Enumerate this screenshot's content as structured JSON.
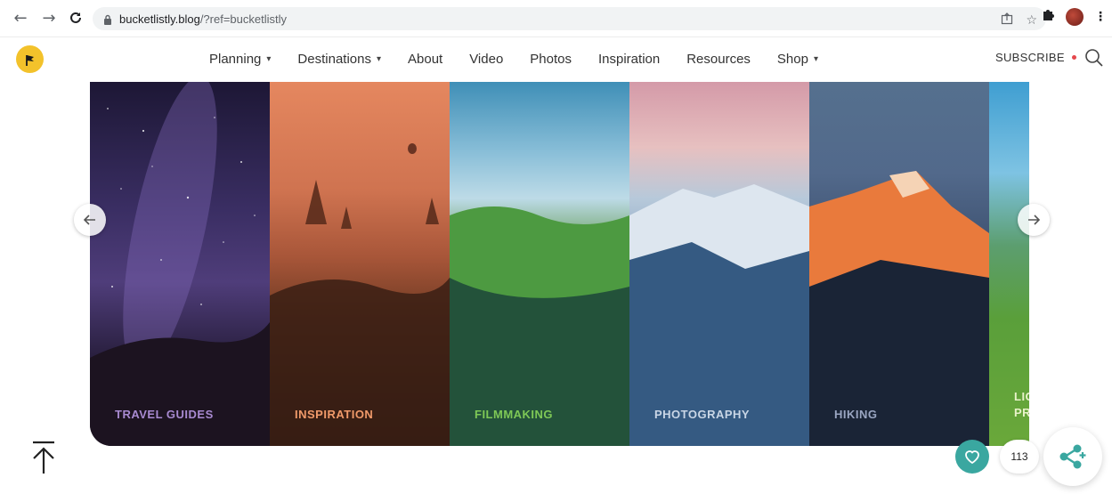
{
  "browser": {
    "url_host": "bucketlistly.blog",
    "url_path": "/?ref=bucketlistly"
  },
  "header": {
    "nav": [
      {
        "label": "Planning",
        "has_menu": true
      },
      {
        "label": "Destinations",
        "has_menu": true
      },
      {
        "label": "About",
        "has_menu": false
      },
      {
        "label": "Video",
        "has_menu": false
      },
      {
        "label": "Photos",
        "has_menu": false
      },
      {
        "label": "Inspiration",
        "has_menu": false
      },
      {
        "label": "Resources",
        "has_menu": false
      },
      {
        "label": "Shop",
        "has_menu": true
      }
    ],
    "subscribe_label": "SUBSCRIBE",
    "accent": "#e5484d"
  },
  "carousel": {
    "panels": [
      {
        "label": "TRAVEL GUIDES",
        "color": "#a88ad1"
      },
      {
        "label": "INSPIRATION",
        "color": "#f09a6a"
      },
      {
        "label": "FILMMAKING",
        "color": "#7ec856"
      },
      {
        "label": "PHOTOGRAPHY",
        "color": "#c9d6e6"
      },
      {
        "label": "HIKING",
        "color": "#9aa6c2"
      },
      {
        "label_line1": "LIG",
        "label_line2": "PR",
        "color": "#e8f2c9"
      }
    ]
  },
  "social": {
    "like_count": "113",
    "like_color": "#3aa7a0",
    "share_color": "#3aa7a0"
  }
}
